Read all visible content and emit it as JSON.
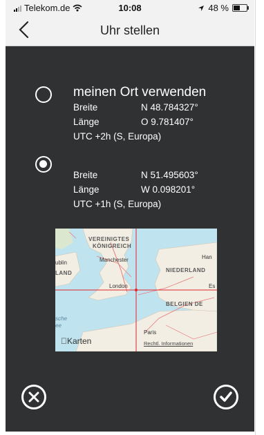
{
  "status_bar": {
    "carrier": "Telekom.de",
    "time": "10:08",
    "battery_text": "48 %",
    "battery_level": 0.48
  },
  "nav": {
    "title": "Uhr stellen",
    "back_icon": "chevron-left-icon"
  },
  "option_own": {
    "title": "meinen Ort verwenden",
    "lat_label": "Breite",
    "lat_value": "N 48.784327°",
    "lon_label": "Länge",
    "lon_value": "O 9.781407°",
    "utc": "UTC +2h  (S, Europa)",
    "selected": false
  },
  "option_map": {
    "lat_label": "Breite",
    "lat_value": "N 51.495603°",
    "lon_label": "Länge",
    "lon_value": "W 0.098201°",
    "utc": "UTC +1h  (S, Europa)",
    "selected": true
  },
  "map": {
    "label_uk1": "VEREINIGTES",
    "label_uk2": "KÖNIGREICH",
    "manchester": "Manchester",
    "dublin": "ublin",
    "land": "LAND",
    "london": "London",
    "niederlande": "NIEDERLAND",
    "han": "Han",
    "belgien": "BELGIEN  DE",
    "ess": "Es",
    "paris": "Paris",
    "sche": "sche",
    "ee": "ee",
    "karten": "Karten",
    "legal": "Rechtl. Informationen"
  },
  "actions": {
    "cancel_icon": "close-icon",
    "confirm_icon": "checkmark-icon"
  },
  "colors": {
    "screen_bg": "#2f3133",
    "map_crosshair": "#e0242a",
    "water": "#bfe3ef",
    "land": "#f2eee4"
  }
}
